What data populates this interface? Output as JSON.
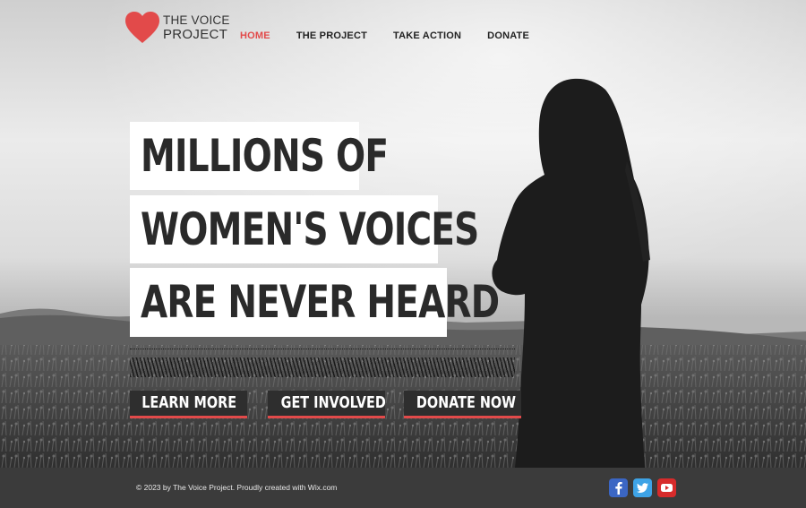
{
  "brand": {
    "line1": "THE VOICE",
    "line2": "PROJECT",
    "heart_color": "#e24a4a"
  },
  "nav": {
    "items": [
      {
        "label": "HOME",
        "active": true
      },
      {
        "label": "THE PROJECT",
        "active": false
      },
      {
        "label": "TAKE ACTION",
        "active": false
      },
      {
        "label": "DONATE",
        "active": false
      }
    ]
  },
  "hero": {
    "headline": [
      "MILLIONS OF",
      "WOMEN'S VOICES",
      "ARE NEVER HEARD"
    ],
    "buttons": {
      "learn_more": "LEARN MORE",
      "get_involved": "GET INVOLVED",
      "donate_now": "DONATE NOW"
    },
    "accent_color": "#e24a4a"
  },
  "footer": {
    "copyright": "© 2023 by The Voice Project. Proudly created with Wix.com",
    "social": [
      {
        "icon": "facebook-icon",
        "color": "#3b66c4"
      },
      {
        "icon": "twitter-icon",
        "color": "#3ea3e6"
      },
      {
        "icon": "youtube-icon",
        "color": "#d72b2b"
      }
    ]
  }
}
